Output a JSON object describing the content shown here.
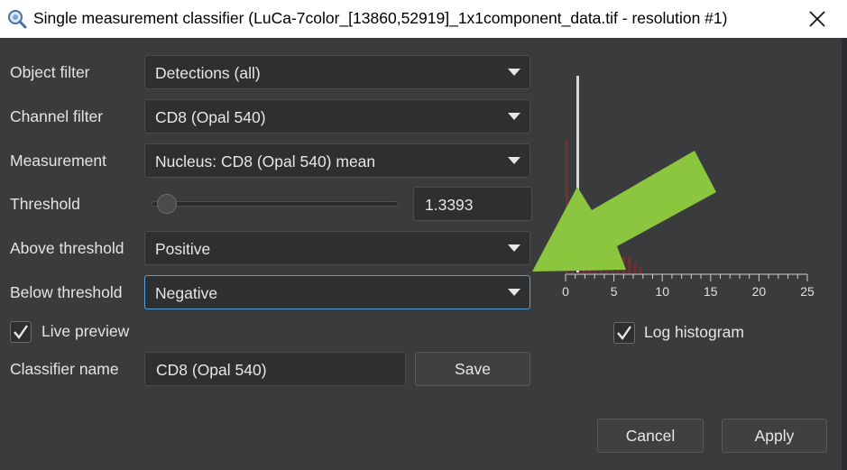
{
  "window": {
    "title": "Single measurement classifier (LuCa-7color_[13860,52919]_1x1component_data.tif - resolution #1)",
    "app_icon": "qupath-magnifier-icon",
    "close_icon": "close-icon"
  },
  "form": {
    "object_filter": {
      "label": "Object filter",
      "value": "Detections (all)"
    },
    "channel_filter": {
      "label": "Channel filter",
      "value": "CD8 (Opal 540)"
    },
    "measurement": {
      "label": "Measurement",
      "value": "Nucleus: CD8 (Opal 540) mean"
    },
    "threshold": {
      "label": "Threshold",
      "value": "1.3393",
      "slider_fraction": 0.06
    },
    "above_threshold": {
      "label": "Above threshold",
      "value": "Positive"
    },
    "below_threshold": {
      "label": "Below threshold",
      "value": "Negative"
    },
    "live_preview": {
      "label": "Live preview",
      "checked": true
    },
    "classifier_name": {
      "label": "Classifier name",
      "value": "CD8 (Opal 540)"
    },
    "save_label": "Save"
  },
  "histogram": {
    "log_histogram": {
      "label": "Log histogram",
      "checked": true
    },
    "x_ticks": [
      "0",
      "5",
      "10",
      "15",
      "20",
      "25"
    ],
    "bar_color": "#7a2e2e",
    "threshold_line_color": "#d8d8d8"
  },
  "annotation": {
    "arrow_color": "#8cc63f"
  },
  "footer": {
    "cancel_label": "Cancel",
    "apply_label": "Apply"
  }
}
